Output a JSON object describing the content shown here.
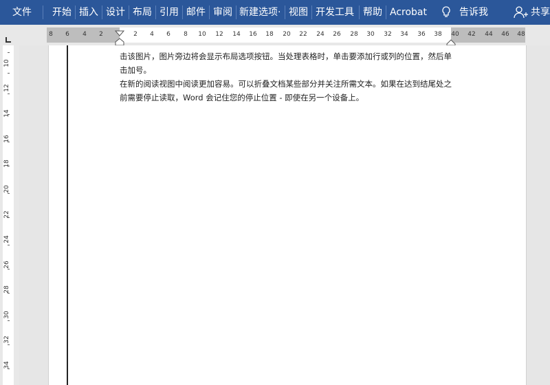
{
  "ribbon": {
    "tabs": [
      "文件",
      "开始",
      "插入",
      "设计",
      "布局",
      "引用",
      "邮件",
      "审阅",
      "新建选项·",
      "视图",
      "开发工具",
      "帮助",
      "Acrobat"
    ],
    "tell_me": "告诉我",
    "share": "共享",
    "colors": {
      "background": "#2b579a",
      "text": "#ffffff"
    }
  },
  "hruler": {
    "left_numbers": [
      "8",
      "6",
      "4",
      "2"
    ],
    "numbers": [
      "2",
      "4",
      "6",
      "8",
      "10",
      "12",
      "14",
      "16",
      "18",
      "20",
      "22",
      "24",
      "26",
      "28",
      "30",
      "32",
      "34",
      "36",
      "38"
    ],
    "right_numbers": [
      "40",
      "42",
      "44",
      "46",
      "48"
    ]
  },
  "vruler": {
    "numbers": [
      "10",
      "12",
      "14",
      "16",
      "18",
      "20",
      "22",
      "24",
      "26",
      "28",
      "30",
      "32",
      "34"
    ]
  },
  "document": {
    "paragraphs": [
      "击该图片，图片旁边将会显示布局选项按钮。当处理表格时，单击要添加行或列的位置，然后单击加号。",
      "在新的阅读视图中阅读更加容易。可以折叠文档某些部分并关注所需文本。如果在达到结尾处之前需要停止读取，Word 会记住您的停止位置 - 即使在另一个设备上。"
    ]
  }
}
